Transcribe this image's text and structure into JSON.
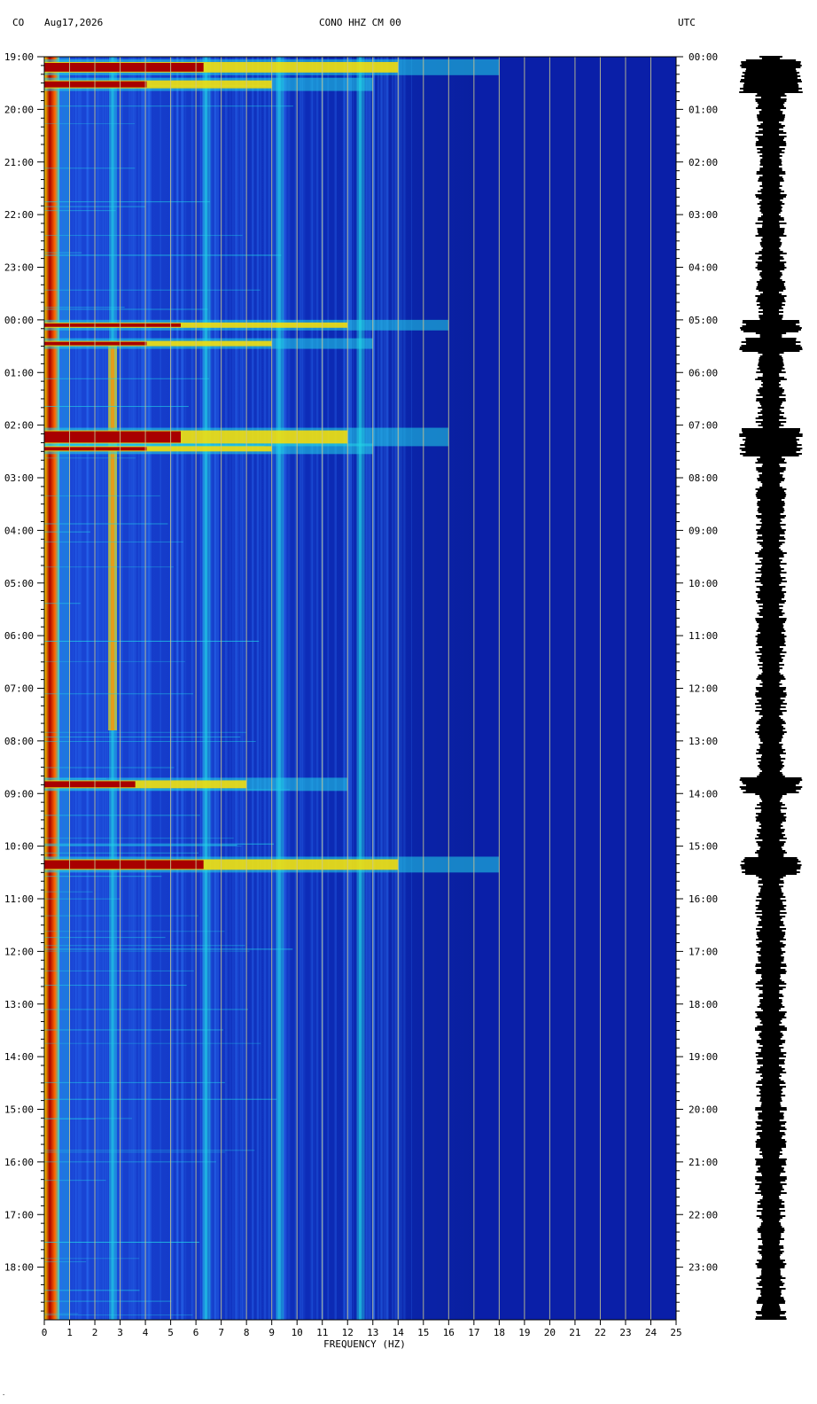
{
  "header": {
    "network": "CO",
    "date": "Aug17,2026",
    "station": "CONO HHZ CM 00",
    "timezone": "UTC"
  },
  "colors": {
    "background_low": "#0a1fa8",
    "mid": "#2a6cf0",
    "high": "#22d6e8",
    "peak_yellow": "#ffe000",
    "peak_red": "#a80000",
    "grid": "#c8c890",
    "trace": "#000000"
  },
  "chart_data": {
    "type": "heatmap",
    "title": "CONO HHZ CM 00",
    "xlabel": "FREQUENCY (HZ)",
    "ylabel": "",
    "xlim": [
      0,
      25
    ],
    "x_ticks": [
      "0",
      "1",
      "2",
      "3",
      "4",
      "5",
      "6",
      "7",
      "8",
      "9",
      "10",
      "11",
      "12",
      "13",
      "14",
      "15",
      "16",
      "17",
      "18",
      "19",
      "20",
      "21",
      "22",
      "23",
      "24",
      "25"
    ],
    "left_time_ticks": [
      "19:00",
      "20:00",
      "21:00",
      "22:00",
      "23:00",
      "00:00",
      "01:00",
      "02:00",
      "03:00",
      "04:00",
      "05:00",
      "06:00",
      "07:00",
      "08:00",
      "09:00",
      "10:00",
      "11:00",
      "12:00",
      "13:00",
      "14:00",
      "15:00",
      "16:00",
      "17:00",
      "18:00"
    ],
    "right_time_ticks": [
      "00:00",
      "01:00",
      "02:00",
      "03:00",
      "04:00",
      "05:00",
      "06:00",
      "07:00",
      "08:00",
      "09:00",
      "10:00",
      "11:00",
      "12:00",
      "13:00",
      "14:00",
      "15:00",
      "16:00",
      "17:00",
      "18:00",
      "19:00",
      "20:00",
      "21:00",
      "22:00",
      "23:00"
    ],
    "rows_hours": 24,
    "grid": true,
    "strong_event_bands_hours": [
      {
        "start": 0.1,
        "end": 0.3,
        "max_hz": 14
      },
      {
        "start": 0.45,
        "end": 0.6,
        "max_hz": 9
      },
      {
        "start": 5.05,
        "end": 5.15,
        "max_hz": 12
      },
      {
        "start": 5.4,
        "end": 5.5,
        "max_hz": 9
      },
      {
        "start": 7.1,
        "end": 7.35,
        "max_hz": 12
      },
      {
        "start": 7.4,
        "end": 7.5,
        "max_hz": 9
      },
      {
        "start": 13.75,
        "end": 13.9,
        "max_hz": 8
      },
      {
        "start": 15.25,
        "end": 15.45,
        "max_hz": 14
      }
    ],
    "persistent_frequency_lines_hz": [
      2.7,
      6.4,
      9.3,
      12.5
    ]
  }
}
